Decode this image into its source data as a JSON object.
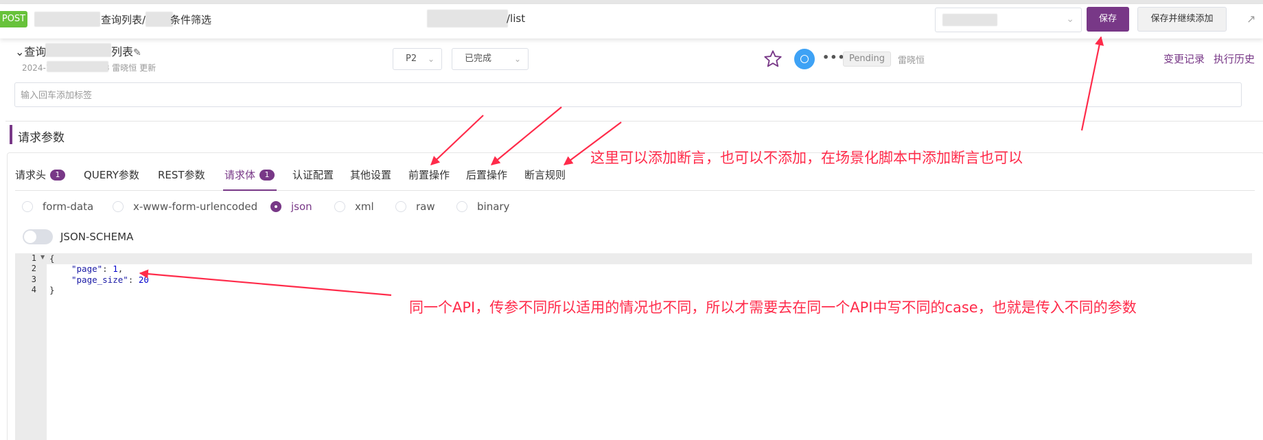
{
  "header": {
    "method": "POST",
    "breadcrumb_suffix": "查询列表/",
    "breadcrumb_end": "条件筛选",
    "url_end": "/list",
    "save_label": "保存",
    "save_continue_label": "保存并继续添加"
  },
  "case": {
    "name_start": "查询",
    "name_end": "列表",
    "meta": "2024-10-25 09:10:18 雷晓恒 更新",
    "priority": "P2",
    "status_select": "已完成",
    "status_tag": "Pending",
    "owner": "雷晓恒",
    "change_log_label": "变更记录",
    "exec_history_label": "执行历史"
  },
  "tags": {
    "placeholder": "输入回车添加标签"
  },
  "section": {
    "title": "请求参数"
  },
  "tabs": [
    {
      "label": "请求头",
      "badge": "1"
    },
    {
      "label": "QUERY参数"
    },
    {
      "label": "REST参数"
    },
    {
      "label": "请求体",
      "badge": "1",
      "active": true
    },
    {
      "label": "认证配置"
    },
    {
      "label": "其他设置"
    },
    {
      "label": "前置操作"
    },
    {
      "label": "后置操作"
    },
    {
      "label": "断言规则"
    }
  ],
  "body_types": [
    {
      "label": "form-data"
    },
    {
      "label": "x-www-form-urlencoded"
    },
    {
      "label": "json",
      "checked": true
    },
    {
      "label": "xml"
    },
    {
      "label": "raw"
    },
    {
      "label": "binary"
    }
  ],
  "schema_switch": {
    "label": "JSON-SCHEMA",
    "on": false
  },
  "editor": {
    "line_numbers": [
      "1",
      "2",
      "3",
      "4"
    ],
    "lines": {
      "l1": "{",
      "l2_key": "\"page\"",
      "l2_sep": ": ",
      "l2_val": "1",
      "l2_end": ",",
      "l3_key": "\"page_size\"",
      "l3_sep": ": ",
      "l3_val": "20",
      "l4": "}"
    }
  },
  "annotations": {
    "assertion_note": "这里可以添加断言，也可以不添加，在场景化脚本中添加断言也可以",
    "params_note": "同一个API，传参不同所以适用的情况也不同，所以才需要去在同一个API中写不同的case，也就是传入不同的参数"
  },
  "colors": {
    "brand": "#783887",
    "method_post": "#67c23a",
    "annotation_red": "#ff2b4a",
    "run_blue": "#3ea2f5"
  },
  "icons": [
    "expand-icon",
    "edit-icon",
    "star-icon",
    "run-icon",
    "more-icon",
    "chevron-down-icon"
  ]
}
